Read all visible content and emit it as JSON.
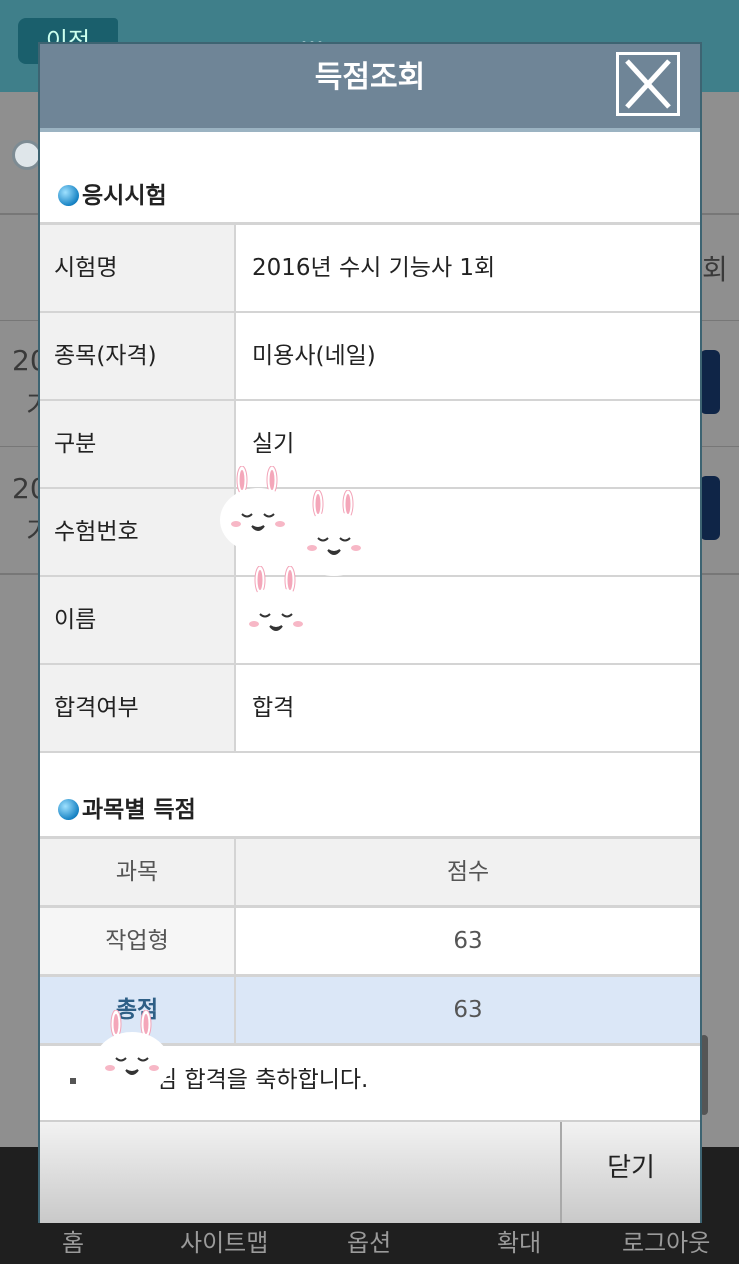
{
  "background": {
    "back_label": "이전",
    "header_title": "…",
    "table_header_fragment": "회",
    "row1_fragment": "20",
    "row1_fragment2": "기",
    "row2_fragment": "20",
    "row2_fragment2": "기",
    "footer_items": [
      "홈",
      "사이트맵",
      "옵션",
      "확대",
      "로그아웃"
    ]
  },
  "dialog": {
    "title": "득점조회",
    "close_icon": "close-x-icon",
    "section_exam": "응시시험",
    "info_rows": [
      {
        "label": "시험명",
        "value": "2016년 수시 기능사 1회"
      },
      {
        "label": "종목(자격)",
        "value": "미용사(네일)"
      },
      {
        "label": "구분",
        "value": "실기"
      },
      {
        "label": "수험번호",
        "value": ""
      },
      {
        "label": "이름",
        "value": ""
      },
      {
        "label": "합격여부",
        "value": "합격"
      }
    ],
    "section_scores": "과목별 득점",
    "score_header": {
      "subject": "과목",
      "score": "점수"
    },
    "score_rows": [
      {
        "subject": "작업형",
        "score": "63"
      }
    ],
    "total": {
      "label": "총점",
      "score": "63"
    },
    "congrats_text": "님 합격을 축하합니다.",
    "close_button": "닫기"
  },
  "colors": {
    "dialog_header": "#6f8597",
    "total_row": "#dbe7f7",
    "bullet_blue": "#1783c4"
  }
}
